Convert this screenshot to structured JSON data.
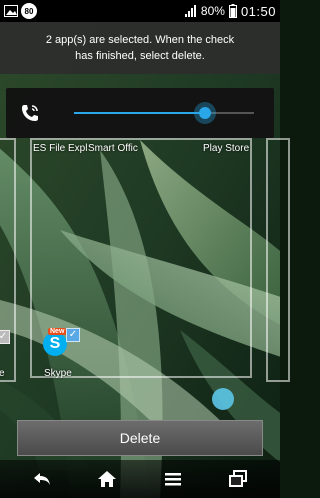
{
  "status_bar": {
    "badge": "80",
    "battery_percent": "80%",
    "time": "01:50"
  },
  "banner": {
    "message": "2 app(s) are selected. When the check has finished, select delete."
  },
  "volume": {
    "level_fraction": 0.73
  },
  "apps": [
    {
      "label": "ES File Expl"
    },
    {
      "label": "Smart Offic"
    },
    {
      "label": "Play Store"
    },
    {
      "label": "Skype"
    },
    {
      "label": "e"
    }
  ],
  "skype_new_badge": "New",
  "delete_button": {
    "label": "Delete"
  },
  "nav": {
    "back_icon": "back-icon",
    "home_icon": "home-icon",
    "menu_icon": "menu-icon",
    "recent_icon": "recent-apps-icon"
  },
  "colors": {
    "accent": "#2aa7e8",
    "skype": "#00aff0"
  }
}
